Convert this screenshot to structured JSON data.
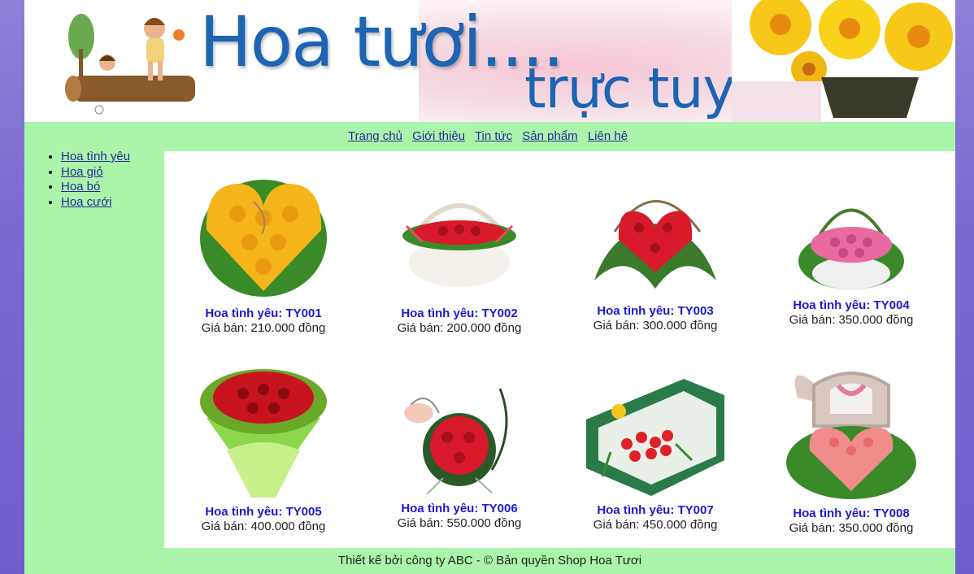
{
  "banner": {
    "title_line1": "Hoa tươi....",
    "title_line2": "trực tuyến"
  },
  "nav": {
    "items": [
      "Trang chủ",
      "Giới thiệu",
      "Tin tức",
      "Sản phẩm",
      "Liên hệ"
    ]
  },
  "sidebar": {
    "items": [
      "Hoa tình yêu",
      "Hoa giỏ",
      "Hoa bó",
      "Hoa cưới"
    ]
  },
  "products": [
    {
      "name": "Hoa tình yêu: TY001",
      "price": "Giá bán: 210.000 đồng",
      "flower_color": "#f4b41a"
    },
    {
      "name": "Hoa tình yêu: TY002",
      "price": "Giá bán: 200.000 đồng",
      "flower_color": "#d81a2a"
    },
    {
      "name": "Hoa tình yêu: TY003",
      "price": "Giá bán: 300.000 đồng",
      "flower_color": "#d81a2a"
    },
    {
      "name": "Hoa tình yêu: TY004",
      "price": "Giá bán: 350.000 đồng",
      "flower_color": "#e86aa0"
    },
    {
      "name": "Hoa tình yêu: TY005",
      "price": "Giá bán: 400.000 đồng",
      "flower_color": "#c8141e"
    },
    {
      "name": "Hoa tình yêu: TY006",
      "price": "Giá bán: 550.000 đồng",
      "flower_color": "#d81a2a"
    },
    {
      "name": "Hoa tình yêu: TY007",
      "price": "Giá bán: 450.000 đồng",
      "flower_color": "#e0202a"
    },
    {
      "name": "Hoa tình yêu: TY008",
      "price": "Giá bán: 350.000 đồng",
      "flower_color": "#f08c8c"
    }
  ],
  "footer": {
    "text": "Thiết kế bởi công ty ABC - © Bản quyền Shop Hoa Tươi"
  },
  "colors": {
    "page_bg": "#aaf5aa",
    "body_bg": "#7a6ad0",
    "link": "#2a2a99",
    "product_name": "#1a1ad4",
    "banner_title": "#1c64b4"
  }
}
